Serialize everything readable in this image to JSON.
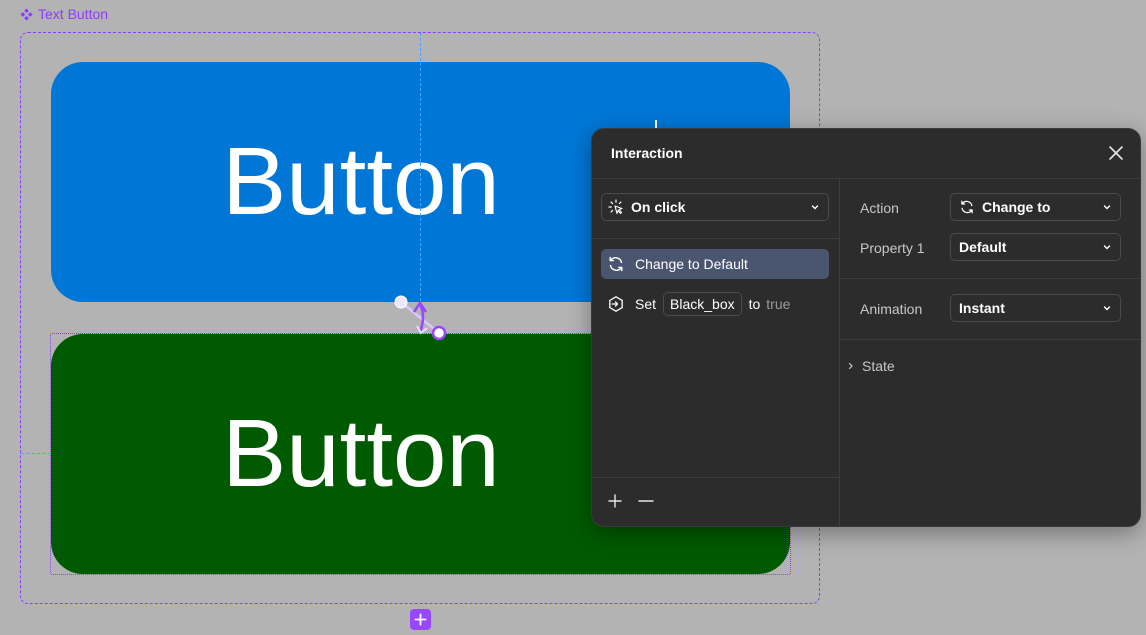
{
  "canvas": {
    "component_label": "Text Button",
    "variants": [
      {
        "text": "Button",
        "color": "#0077d6"
      },
      {
        "text": "Button",
        "color": "#005a00"
      }
    ],
    "accent_color": "#8b3dff"
  },
  "panel": {
    "title": "Interaction",
    "trigger": {
      "label": "On click",
      "icon": "click-cursor-icon"
    },
    "actions": [
      {
        "label": "Change to Default",
        "icon": "change-to-icon",
        "selected": true
      },
      {
        "prefix": "Set",
        "variable": "Black_box",
        "connector": "to",
        "value": "true",
        "icon": "set-variable-icon",
        "selected": false
      }
    ],
    "fields": {
      "action_label": "Action",
      "action_value": "Change to",
      "property_label": "Property 1",
      "property_value": "Default",
      "animation_label": "Animation",
      "animation_value": "Instant"
    },
    "state_label": "State"
  }
}
